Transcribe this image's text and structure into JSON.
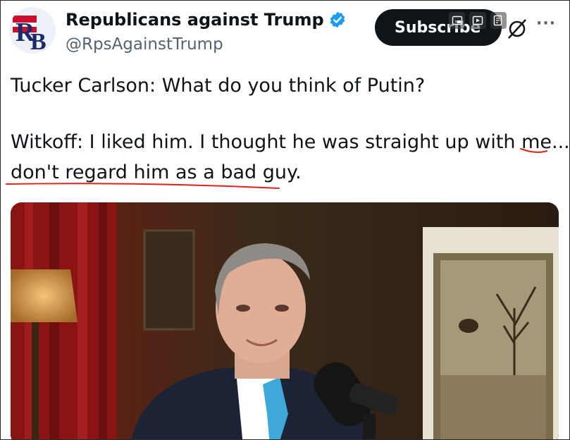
{
  "account": {
    "display_name": "Republicans against Trump",
    "handle": "@RpsAgainstTrump",
    "avatar_letters": "RB"
  },
  "subscribe_label": "Subscribe",
  "more_label": "···",
  "post": {
    "line1": "Tucker Carlson: What do you think of Putin?",
    "line2": "Witkoff: I liked him. I thought he was straight up with me...I",
    "line3": "don't regard him as a bad guy."
  },
  "icons": [
    "verified-badge",
    "picture-in-picture",
    "play-in-window",
    "edit-note",
    "grok",
    "more"
  ],
  "colors": {
    "subscribe_bg": "#0f1419",
    "verified": "#1d9bf0",
    "underline": "#e0241b"
  },
  "media": {
    "kind": "video still"
  }
}
